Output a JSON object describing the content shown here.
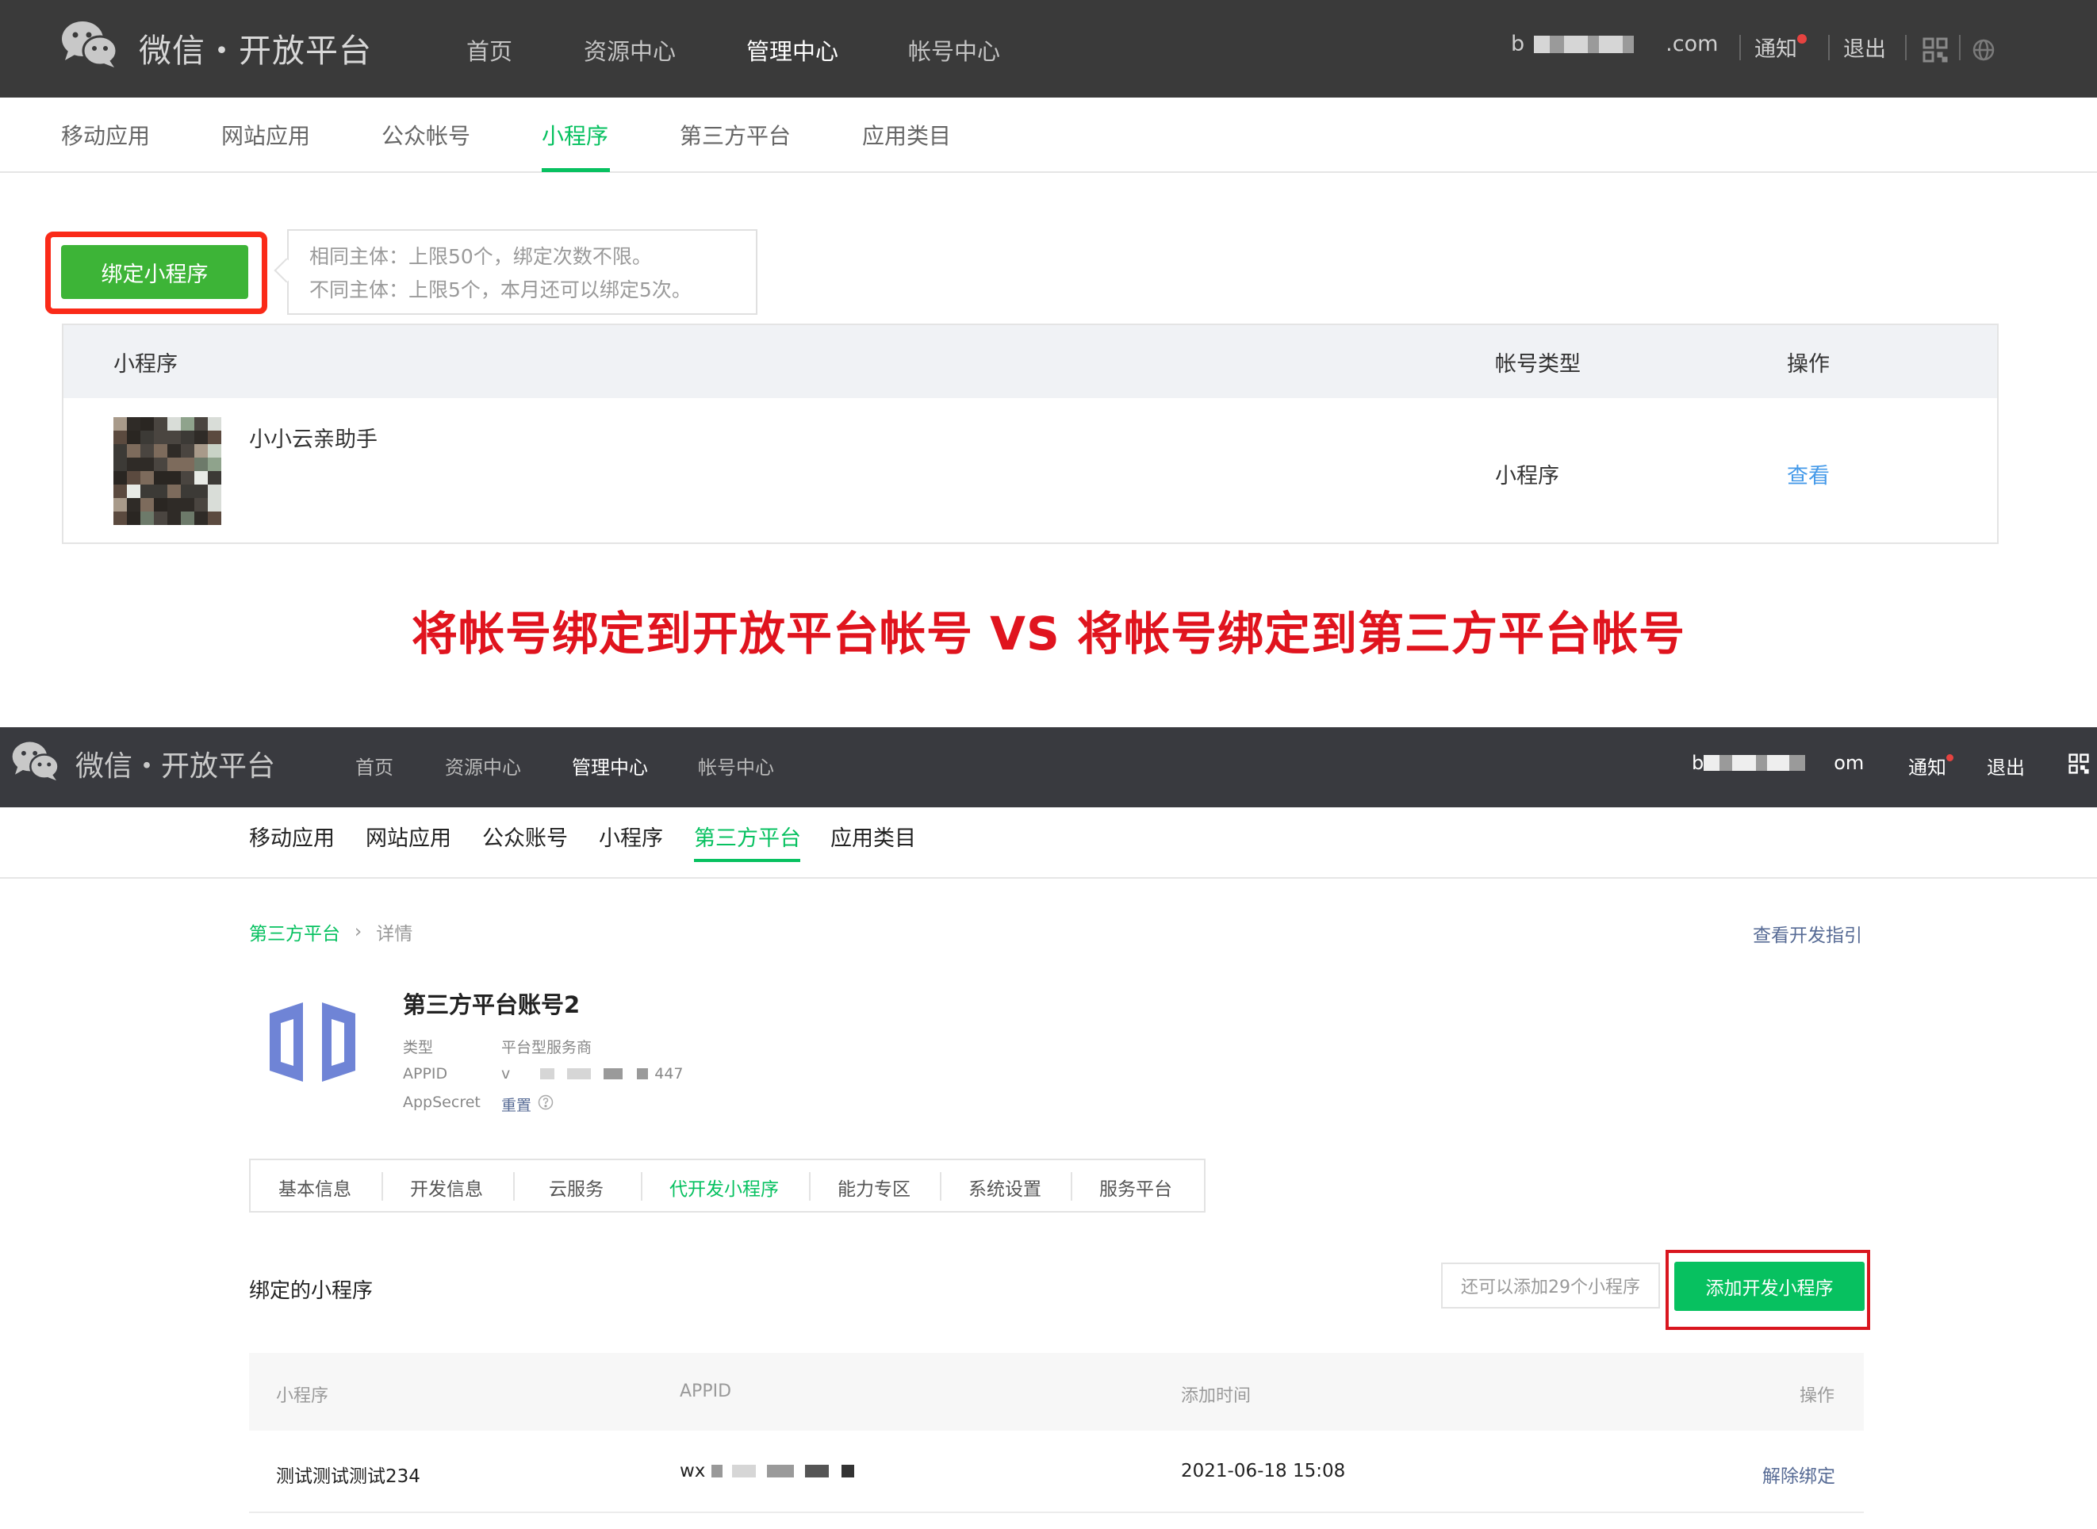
{
  "top": {
    "brand": "微信・开放平台",
    "menu": [
      "首页",
      "资源中心",
      "管理中心",
      "帐号中心"
    ],
    "account_prefix": "b",
    "account_suffix": ".com",
    "notify": "通知",
    "logout": "退出",
    "subnav": [
      "移动应用",
      "网站应用",
      "公众帐号",
      "小程序",
      "第三方平台",
      "应用类目"
    ],
    "bind_button": "绑定小程序",
    "tip_line1": "相同主体：上限50个，绑定次数不限。",
    "tip_line2": "不同主体：上限5个，本月还可以绑定5次。",
    "table_headers": [
      "小程序",
      "帐号类型",
      "操作"
    ],
    "row": {
      "name": "小小云亲助手",
      "type": "小程序",
      "action": "查看"
    }
  },
  "headline": "将帐号绑定到开放平台帐号 VS 将帐号绑定到第三方平台帐号",
  "bottom": {
    "brand": "微信・开放平台",
    "menu": [
      "首页",
      "资源中心",
      "管理中心",
      "帐号中心"
    ],
    "account_prefix": "b",
    "account_suffix": "om",
    "notify": "通知",
    "logout": "退出",
    "subnav": [
      "移动应用",
      "网站应用",
      "公众账号",
      "小程序",
      "第三方平台",
      "应用类目"
    ],
    "breadcrumb_link": "第三方平台",
    "breadcrumb_sep": "›",
    "breadcrumb_current": "详情",
    "guide_link": "查看开发指引",
    "platform_name": "第三方平台账号2",
    "meta_type_label": "类型",
    "meta_type_value": "平台型服务商",
    "meta_appid_label": "APPID",
    "meta_appid_prefix": "v",
    "meta_appid_suffix": "447",
    "meta_secret_label": "AppSecret",
    "meta_secret_action": "重置",
    "tabs": [
      "基本信息",
      "开发信息",
      "云服务",
      "代开发小程序",
      "能力专区",
      "系统设置",
      "服务平台"
    ],
    "section_title": "绑定的小程序",
    "quota_text": "还可以添加29个小程序",
    "add_button": "添加开发小程序",
    "table_headers": [
      "小程序",
      "APPID",
      "添加时间",
      "操作"
    ],
    "row": {
      "name": "测试测试测试234",
      "appid_prefix": "wx",
      "time": "2021-06-18 15:08",
      "action": "解除绑定"
    }
  },
  "colors": {
    "green": "#07c160",
    "red_annotation": "#e0141e",
    "link_blue": "#459ae9",
    "nav_dark": "#393a3f"
  }
}
